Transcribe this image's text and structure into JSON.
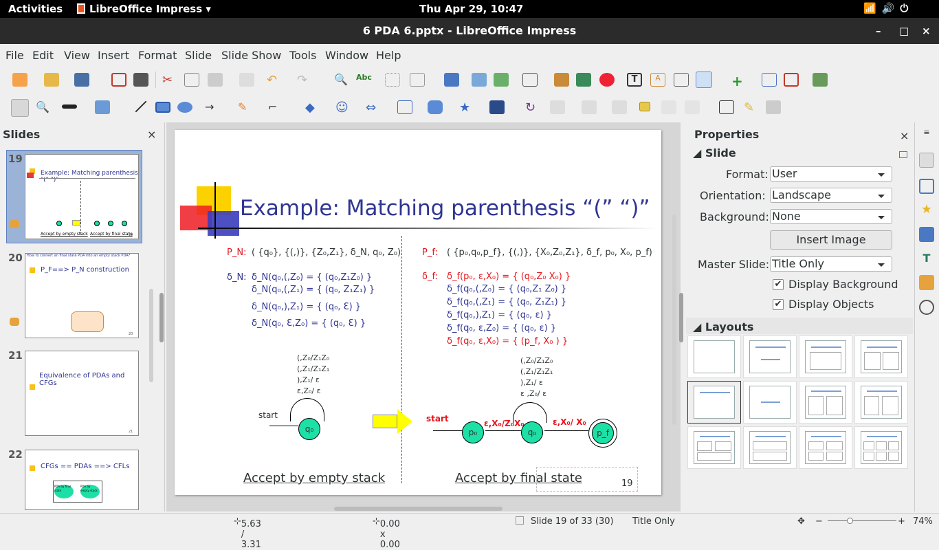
{
  "topbar": {
    "activities": "Activities",
    "app": "LibreOffice Impress",
    "clock": "Thu Apr 29, 10:47",
    "tray": "📶🔊⏻"
  },
  "window": {
    "title": "6 PDA 6.pptx - LibreOffice Impress",
    "min": "–",
    "max": "□",
    "close": "×"
  },
  "menu": [
    "File",
    "Edit",
    "View",
    "Insert",
    "Format",
    "Slide",
    "Slide Show",
    "Tools",
    "Window",
    "Help"
  ],
  "slides_panel": {
    "header": "Slides",
    "close": "×",
    "thumbs": [
      {
        "num": "19",
        "title": "Example: Matching parenthesis \"(\" \")\"",
        "foot1": "Accept by empty stack",
        "foot2": "Accept by final state",
        "pg": "19"
      },
      {
        "num": "20",
        "title": "P_F==> P_N construction",
        "pg": "20",
        "sub": "How to convert an final state PDA into an empty stack PDA?"
      },
      {
        "num": "21",
        "title": "Equivalence of PDAs and CFGs",
        "pg": "21"
      },
      {
        "num": "22",
        "title": "CFGs == PDAs ==> CFLs",
        "box1": "PDA by final state",
        "box2": "PDA by empty stack"
      }
    ]
  },
  "slide": {
    "title": "Example: Matching parenthesis “(” “)”",
    "left": {
      "pn_label": "P_N:",
      "pn_def": "( {q₀}, {(,)}, {Z₀,Z₁}, δ_N, q₀, Z₀)",
      "delta_label": "δ_N:",
      "rules": [
        "δ_N(q₀,(,Z₀) = { (q₀,Z₁Z₀) }",
        "δ_N(q₀,(,Z₁) = { (q₀, Z₁Z₁) }",
        "δ_N(q₀,),Z₁) = { (q₀, Ɛ) }",
        "δ_N(q₀, Ɛ,Z₀) = { (q₀, Ɛ) }"
      ],
      "loop": [
        "(,Z₀/Z₁Z₀",
        "(,Z₁/Z₁Z₁",
        "),Z₁/ ε",
        "ε,Z₀/ ε"
      ],
      "start": "start",
      "state": "q₀",
      "caption": "Accept by empty stack"
    },
    "right": {
      "pf_label": "P_f:",
      "pf_def": "( {p₀,q₀,p_f}, {(,)}, {X₀,Z₀,Z₁}, δ_f, p₀, X₀, p_f)",
      "delta_label": "δ_f:",
      "rules_red1": "δ_f(p₀, ε,X₀) = { (q₀,Z₀ X₀) }",
      "rules": [
        "δ_f(q₀,(,Z₀) = { (q₀,Z₁ Z₀) }",
        "δ_f(q₀,(,Z₁) = { (q₀, Z₁Z₁) }",
        "δ_f(q₀,),Z₁) = { (q₀, ε) }",
        "δ_f(q₀, ε,Z₀) = { (q₀, ε) }"
      ],
      "rules_red2": "δ_f(q₀, ε,X₀) = { (p_f, X₀ ) }",
      "loop": [
        "(,Z₀/Z₁Z₀",
        "(,Z₁/Z₁Z₁",
        "),Z₁/ ε",
        "ε ,Z₀/ ε"
      ],
      "start": "start",
      "states": [
        "p₀",
        "q₀",
        "p_f"
      ],
      "edge1": "ε,X₀/Z₀X₀",
      "edge2": "ε,X₀/ X₀",
      "caption": "Accept by final state",
      "page": "19"
    }
  },
  "properties": {
    "header": "Properties",
    "close": "×",
    "section_slide": "Slide",
    "format_label": "Format:",
    "format_value": "User",
    "orientation_label": "Orientation:",
    "orientation_value": "Landscape",
    "background_label": "Background:",
    "background_value": "None",
    "insert_image": "Insert Image",
    "master_label": "Master Slide:",
    "master_value": "Title Only",
    "display_bg": "Display Background",
    "display_obj": "Display Objects",
    "section_layouts": "Layouts"
  },
  "status": {
    "position": "5.63 / 3.31",
    "size": "0.00 x 0.00",
    "slide": "Slide 19 of 33 (30)",
    "layout": "Title Only",
    "zoom": "74%"
  }
}
